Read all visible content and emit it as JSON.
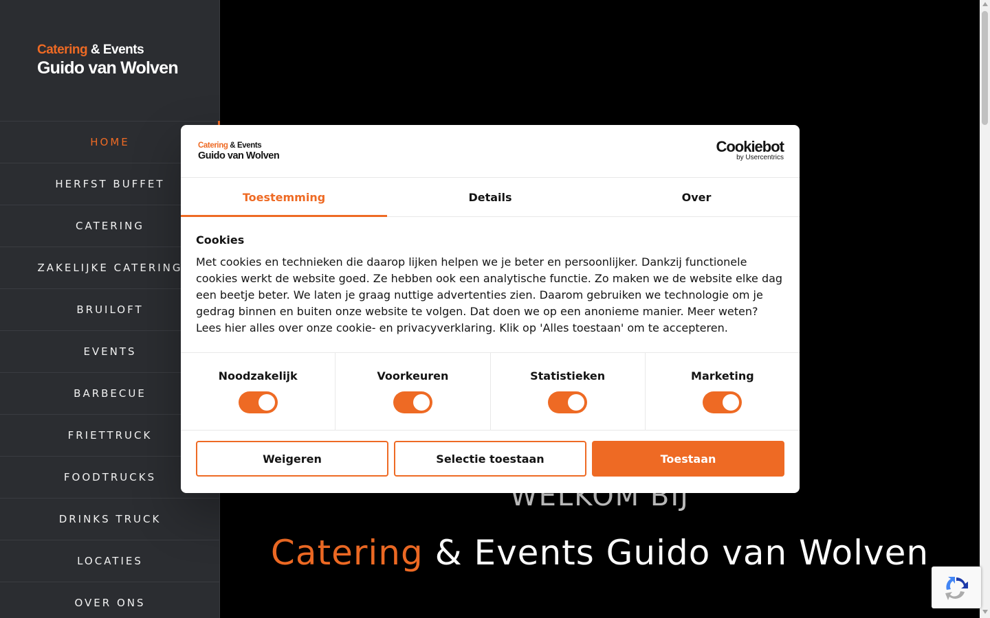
{
  "sidebar": {
    "logo": {
      "line1_accent": "Catering",
      "line1_rest": " & Events",
      "line2": "Guido van Wolven"
    },
    "nav": [
      {
        "label": "HOME",
        "active": true
      },
      {
        "label": "HERFST BUFFET"
      },
      {
        "label": "CATERING"
      },
      {
        "label": "ZAKELIJKE CATERING"
      },
      {
        "label": "BRUILOFT"
      },
      {
        "label": "EVENTS"
      },
      {
        "label": "BARBECUE"
      },
      {
        "label": "FRIETTRUCK"
      },
      {
        "label": "FOODTRUCKS"
      },
      {
        "label": "DRINKS TRUCK"
      },
      {
        "label": "LOCATIES"
      },
      {
        "label": "OVER ONS"
      }
    ]
  },
  "hero": {
    "welcome": "WELKOM BIJ",
    "title_accent": "Catering",
    "title_rest": " & Events Guido van Wolven"
  },
  "cookie_dialog": {
    "logo": {
      "line1_accent": "Catering",
      "line1_rest": " & Events",
      "line2": "Guido van Wolven"
    },
    "provider": {
      "name": "Cookiebot",
      "by": "by Usercentrics"
    },
    "tabs": [
      {
        "label": "Toestemming",
        "active": true
      },
      {
        "label": "Details"
      },
      {
        "label": "Over"
      }
    ],
    "heading": "Cookies",
    "text": "Met cookies en technieken die daarop lijken helpen we je beter en persoonlijker. Dankzij functionele cookies werkt de website goed. Ze hebben ook een analytische functie. Zo maken we de website elke dag een beetje beter. We laten je graag nuttige advertenties zien. Daarom gebruiken we technologie om je gedrag binnen en buiten onze website te volgen. Dat doen we op een anonieme manier. Meer weten? Lees hier alles over onze cookie- en privacyverklaring. Klik op 'Alles toestaan' om te accepteren.",
    "toggles": [
      {
        "label": "Noodzakelijk",
        "on": true
      },
      {
        "label": "Voorkeuren",
        "on": true
      },
      {
        "label": "Statistieken",
        "on": true
      },
      {
        "label": "Marketing",
        "on": true
      }
    ],
    "buttons": {
      "deny": "Weigeren",
      "allow_selection": "Selectie toestaan",
      "allow_all": "Toestaan"
    }
  },
  "colors": {
    "accent": "#ee6a24",
    "sidebar_bg": "#2b2d31",
    "page_bg": "#000000"
  }
}
